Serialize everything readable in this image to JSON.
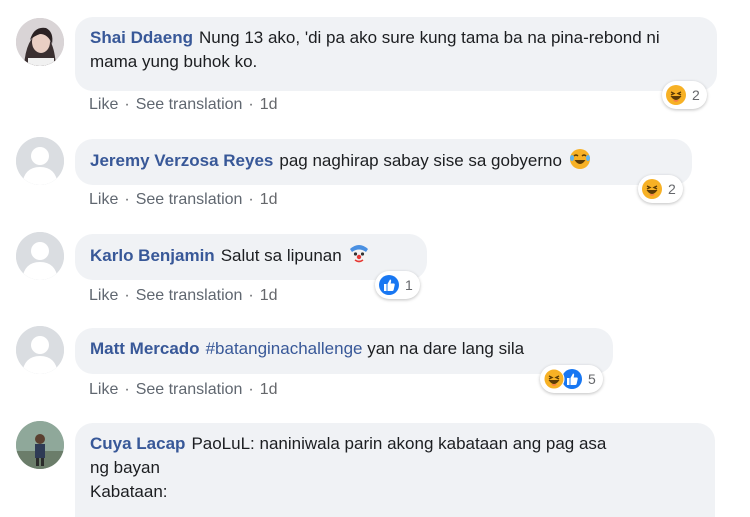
{
  "comments": [
    {
      "author": "Shai Ddaeng",
      "text": "Nung 13 ako, 'di pa ako sure kung tama ba na pina-rebond ni mama yung buhok ko.",
      "actions": {
        "like": "Like",
        "translate": "See translation",
        "time": "1d"
      },
      "reaction_count": "2",
      "reactions": [
        "haha-icon"
      ]
    },
    {
      "author": "Jeremy Verzosa Reyes",
      "text": "pag naghirap sabay sise sa gobyerno",
      "emoji": "tears-of-joy-emoji",
      "actions": {
        "like": "Like",
        "translate": "See translation",
        "time": "1d"
      },
      "reaction_count": "2",
      "reactions": [
        "haha-icon"
      ]
    },
    {
      "author": "Karlo Benjamin",
      "text": "Salut sa lipunan",
      "emoji": "clown-emoji",
      "actions": {
        "like": "Like",
        "translate": "See translation",
        "time": "1d"
      },
      "reaction_count": "1",
      "reactions": [
        "like-icon"
      ]
    },
    {
      "author": "Matt Mercado",
      "hashtag": "#batanginachallenge",
      "text": "yan na dare lang sila",
      "actions": {
        "like": "Like",
        "translate": "See translation",
        "time": "1d"
      },
      "reaction_count": "5",
      "reactions": [
        "haha-icon",
        "like-icon"
      ]
    },
    {
      "author": "Cuya Lacap",
      "text_line1": "PaoLuL: naniniwala parin akong kabataan ang pag asa",
      "text_line2": "ng bayan",
      "text_line3": "Kabataan:"
    }
  ],
  "colors": {
    "author": "#385898",
    "bubble": "#f0f2f5",
    "meta": "#65676b",
    "like_blue": "#1877f2",
    "haha_yellow": "#f7b125"
  }
}
